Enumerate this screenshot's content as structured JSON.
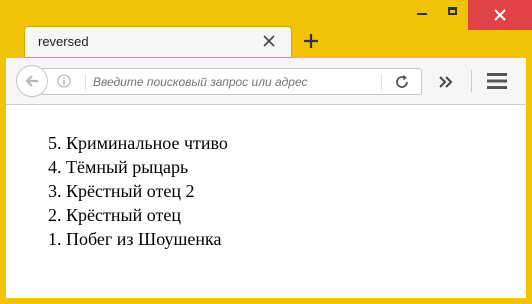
{
  "window": {
    "controls": {
      "minimize_icon": "minimize-icon",
      "maximize_icon": "maximize-icon",
      "close_icon": "close-icon"
    }
  },
  "tab": {
    "title": "reversed"
  },
  "navbar": {
    "url_placeholder": "Введите поисковый запрос или адрес"
  },
  "content": {
    "items": [
      "5. Криминальное чтиво",
      "4. Тёмный рыцарь",
      "3. Крёстный отец 2",
      "2. Крёстный отец",
      "1. Побег из Шоушенка"
    ]
  },
  "colors": {
    "frame": "#f2c304",
    "close_button": "#e04343"
  }
}
